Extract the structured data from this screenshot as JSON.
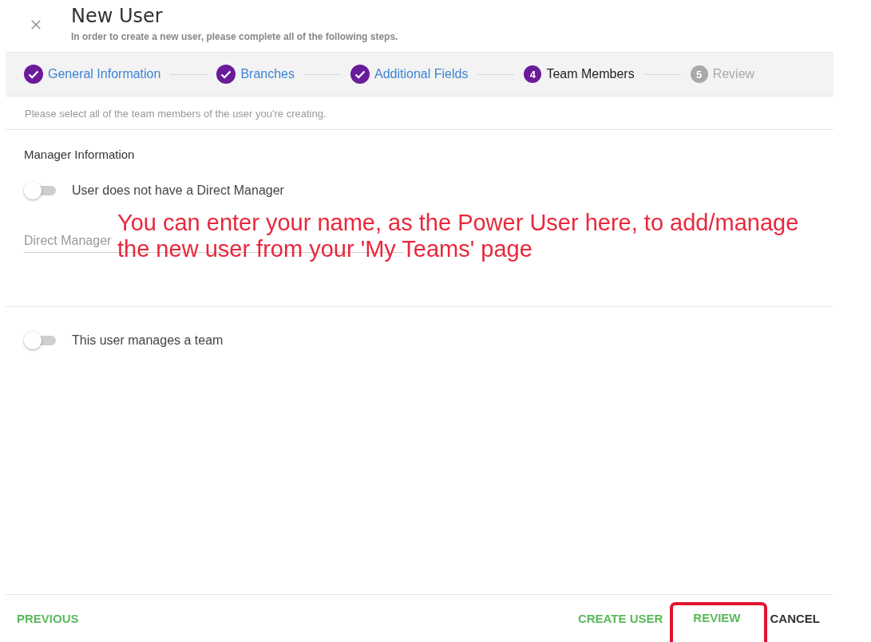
{
  "dialog": {
    "title": "New User",
    "subtitle": "In order to create a new user, please complete all of the following steps."
  },
  "steps": [
    {
      "label": "General Information",
      "kind": "done"
    },
    {
      "label": "Branches",
      "kind": "done"
    },
    {
      "label": "Additional Fields",
      "kind": "done"
    },
    {
      "number": "4",
      "label": "Team Members",
      "kind": "current"
    },
    {
      "number": "5",
      "label": "Review",
      "kind": "upcoming"
    }
  ],
  "hint": "Please select all of the team members of the user you're creating.",
  "section_title": "Manager Information",
  "no_manager_toggle": {
    "label": "User does not have a Direct Manager",
    "on": false
  },
  "direct_manager_field": {
    "placeholder": "Direct Manager"
  },
  "manages_team_toggle": {
    "label": "This user manages a team",
    "on": false
  },
  "annotation": {
    "lines": [
      "You can enter your name, as the Power User here, to add/manage",
      "the new user from your 'My Teams' page"
    ]
  },
  "footer": {
    "previous": "PREVIOUS",
    "buttons": [
      {
        "label": "CREATE USER",
        "highlighted": false
      },
      {
        "label": "REVIEW",
        "highlighted": true
      },
      {
        "label": "CANCEL",
        "highlighted": false,
        "kind": "dark"
      }
    ]
  }
}
